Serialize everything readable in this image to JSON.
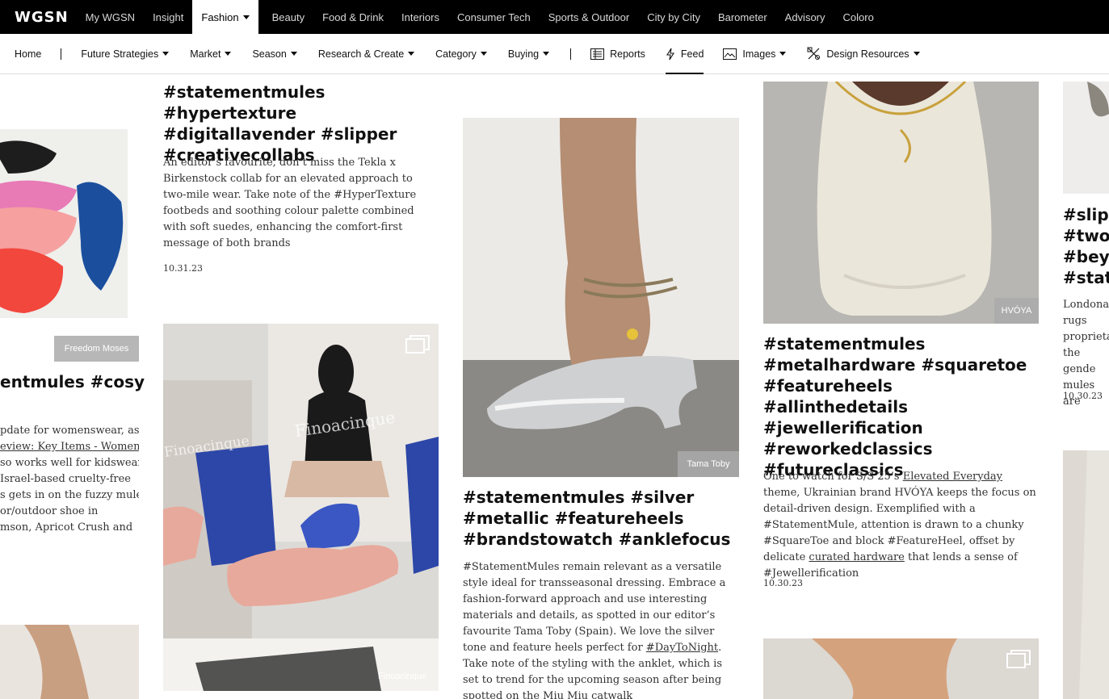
{
  "topnav": {
    "logo": "WGSN",
    "items": [
      "My WGSN",
      "Insight",
      "Fashion",
      "Beauty",
      "Food & Drink",
      "Interiors",
      "Consumer Tech",
      "Sports & Outdoor",
      "City by City",
      "Barometer",
      "Advisory",
      "Coloro"
    ],
    "active": "Fashion"
  },
  "subnav": {
    "home": "Home",
    "future": "Future Strategies",
    "market": "Market",
    "season": "Season",
    "research": "Research & Create",
    "category": "Category",
    "buying": "Buying",
    "reports": "Reports",
    "feed": "Feed",
    "images": "Images",
    "design": "Design Resources"
  },
  "cards": {
    "c1": {
      "credit": "Freedom Moses",
      "tags": "entmules #cosy",
      "desc_1": "pdate for womenswear, as",
      "desc_2_link": "eview: Key Items - Women’s",
      "desc_3": "so works well for kidswear",
      "desc_4": " Israel-based cruelty-free",
      "desc_5": "s gets in on the fuzzy mule",
      "desc_6": "or/outdoor shoe in",
      "desc_7": "mson, Apricot Crush and"
    },
    "c2": {
      "tags": "#statementmules #hypertexture #digitallavender #slipper #creativecollabs",
      "desc": "An editor’s favourite, don’t miss the Tekla x Birkenstock collab for an elevated approach to two-mile wear. Take note of the #HyperTexture footbeds and soothing colour palette combined with soft suedes, enhancing the comfort-first message of both brands",
      "date": "10.31.23",
      "credit": "Finoacinque",
      "watermark": "Finoacinque"
    },
    "c3": {
      "credit": "Tama Toby",
      "tags": "#statementmules #silver #metallic #featureheels #brandstowatch #anklefocus",
      "desc_pre": "#StatementMules remain relevant as a versatile style ideal for transseasonal dressing. Embrace a fashion-forward approach and use interesting materials and details, as spotted in our editor’s favourite Tama Toby (Spain). We love the silver tone and feature heels perfect for ",
      "desc_link": "#DayToNight",
      "desc_post": ". Take note of the styling with the anklet, which is set to trend for the upcoming season after being spotted on the Miu Miu catwalk"
    },
    "c4": {
      "credit": "HVÓYA",
      "tags": "#statementmules #metalhardware #squaretoe #featureheels #allinthedetails #jewellerification #reworkedclassics #futureclassics",
      "desc_a": "One to watch for S/S 25’s ",
      "desc_link1": "Elevated Everyday",
      "desc_b": " theme, Ukrainian brand HVÓYA keeps the focus on detail-driven design. Exemplified with a #StatementMule, attention is drawn to a chunky #SquareToe and block #FeatureHeel, offset by delicate ",
      "desc_link2": "curated hardware",
      "desc_c": " that lends a sense of #Jewellerification",
      "date": "10.30.23"
    },
    "c5": {
      "tags": "#slipp #twor #beyo #state",
      "desc": "Londonand rugs proprieta the gende mules are",
      "date": "10.30.23"
    }
  }
}
